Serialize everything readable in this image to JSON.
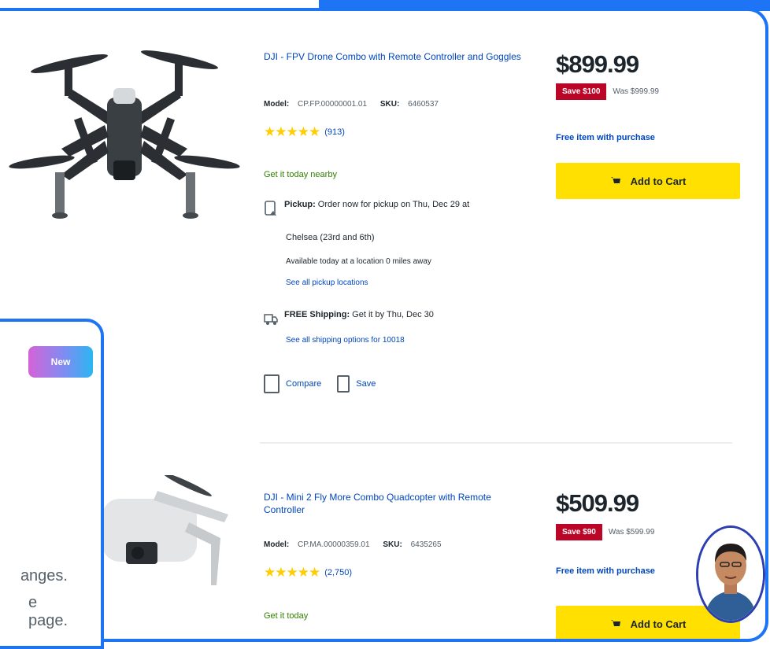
{
  "products": [
    {
      "title": "DJI - FPV Drone Combo with Remote Controller and Goggles",
      "model_label": "Model:",
      "model_value": "CP.FP.00000001.01",
      "sku_label": "SKU:",
      "sku_value": "6460537",
      "rating_count": "(913)",
      "get_it": "Get it today nearby",
      "pickup_label": "Pickup:",
      "pickup_text": "Order now for pickup on Thu, Dec 29 at",
      "pickup_store": "Chelsea (23rd and 6th)",
      "pickup_available": "Available today at a location 0 miles away",
      "pickup_link": "See all pickup locations",
      "shipping_label": "FREE Shipping:",
      "shipping_text": "Get it by Thu, Dec 30",
      "shipping_link": "See all shipping options for 10018",
      "compare": "Compare",
      "save": "Save",
      "price": "$899.99",
      "save_badge": "Save $100",
      "was": "Was $999.99",
      "free_item": "Free item with purchase",
      "add_to_cart": "Add to Cart"
    },
    {
      "title": "DJI - Mini 2 Fly More Combo Quadcopter with Remote Controller",
      "model_label": "Model:",
      "model_value": "CP.MA.00000359.01",
      "sku_label": "SKU:",
      "sku_value": "6435265",
      "rating_count": "(2,750)",
      "get_it": "Get it today",
      "compare": "",
      "save": "",
      "price": "$509.99",
      "save_badge": "Save $90",
      "was": "Was $599.99",
      "free_item": "Free item with purchase",
      "add_to_cart": "Add to Cart"
    }
  ],
  "overlay": {
    "badge": "New",
    "line1": "anges.",
    "line2": "e page."
  },
  "colors": {
    "accent": "#1d74f5",
    "cart_yellow": "#ffe000",
    "sale_red": "#bb0628",
    "link_blue": "#0046be",
    "green": "#318000"
  }
}
